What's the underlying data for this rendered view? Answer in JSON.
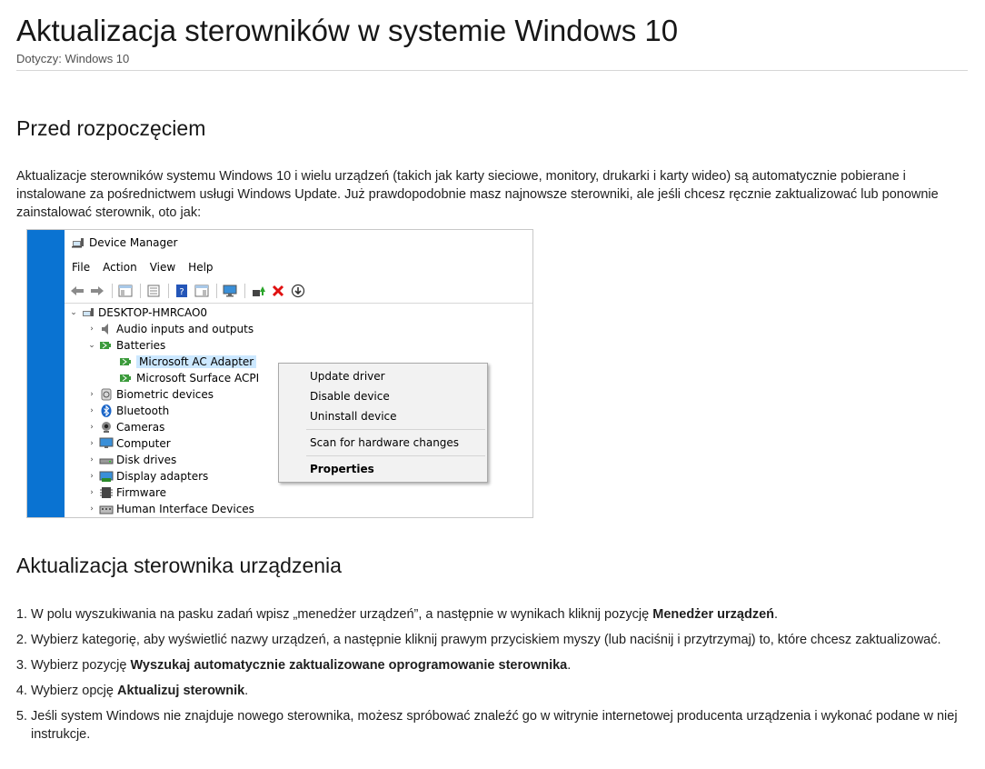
{
  "article": {
    "title": "Aktualizacja sterowników w systemie Windows 10",
    "applies_to": "Dotyczy: Windows 10"
  },
  "section1": {
    "heading": "Przed rozpoczęciem",
    "paragraph": "Aktualizacje sterowników systemu Windows 10 i wielu urządzeń (takich jak karty sieciowe, monitory, drukarki i karty wideo) są automatycznie pobierane i instalowane za pośrednictwem usługi Windows Update. Już prawdopodobnie masz najnowsze sterowniki, ale jeśli chcesz ręcznie zaktualizować lub ponownie zainstalować sterownik, oto jak:"
  },
  "screenshot": {
    "window_title": "Device Manager",
    "menu": [
      "File",
      "Action",
      "View",
      "Help"
    ],
    "tree": {
      "root": "DESKTOP-HMRCAO0",
      "items": [
        "Audio inputs and outputs",
        "Batteries",
        "Microsoft AC Adapter",
        "Microsoft Surface ACPI",
        "Biometric devices",
        "Bluetooth",
        "Cameras",
        "Computer",
        "Disk drives",
        "Display adapters",
        "Firmware",
        "Human Interface Devices"
      ]
    },
    "context_menu": {
      "update": "Update driver",
      "disable": "Disable device",
      "uninstall": "Uninstall device",
      "scan": "Scan for hardware changes",
      "properties": "Properties"
    },
    "colors": {
      "accent_blue": "#0a73d2",
      "selection": "#cce8ff"
    }
  },
  "section2": {
    "heading": "Aktualizacja sterownika urządzenia",
    "steps": [
      {
        "pre": "W polu wyszukiwania na pasku zadań wpisz „menedżer urządzeń”, a następnie w wynikach kliknij pozycję ",
        "bold": "Menedżer urządzeń",
        "post": "."
      },
      {
        "pre": "Wybierz kategorię, aby wyświetlić nazwy urządzeń, a następnie kliknij prawym przyciskiem myszy (lub naciśnij i przytrzymaj) to, które chcesz zaktualizować.",
        "bold": "",
        "post": ""
      },
      {
        "pre": "Wybierz pozycję ",
        "bold": "Wyszukaj automatycznie zaktualizowane oprogramowanie sterownika",
        "post": "."
      },
      {
        "pre": "Wybierz opcję ",
        "bold": "Aktualizuj sterownik",
        "post": "."
      },
      {
        "pre": "Jeśli system Windows nie znajduje nowego sterownika, możesz spróbować znaleźć go w witrynie internetowej producenta urządzenia i wykonać podane w niej instrukcje.",
        "bold": "",
        "post": ""
      }
    ]
  }
}
